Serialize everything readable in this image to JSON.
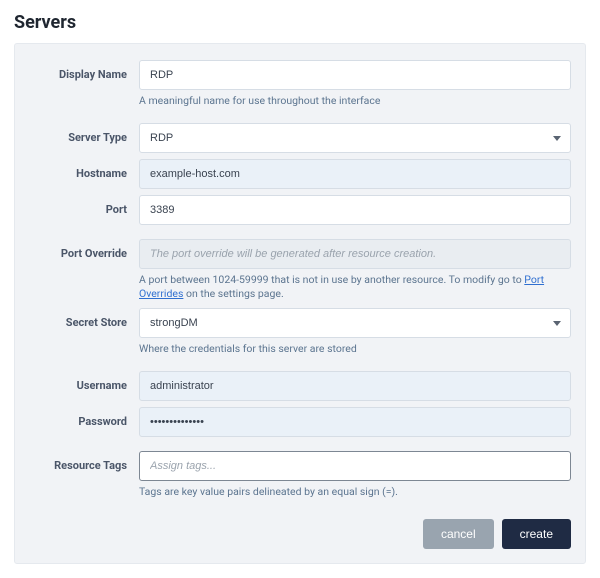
{
  "page": {
    "title": "Servers"
  },
  "fields": {
    "display_name": {
      "label": "Display Name",
      "value": "RDP",
      "hint": "A meaningful name for use throughout the interface"
    },
    "server_type": {
      "label": "Server Type",
      "value": "RDP"
    },
    "hostname": {
      "label": "Hostname",
      "value": "example-host.com"
    },
    "port": {
      "label": "Port",
      "value": "3389"
    },
    "port_override": {
      "label": "Port Override",
      "placeholder": "The port override will be generated after resource creation.",
      "hint_prefix": "A port between 1024-59999 that is not in use by another resource. To modify go to ",
      "hint_link": "Port Overrides",
      "hint_suffix": " on the settings page."
    },
    "secret_store": {
      "label": "Secret Store",
      "value": "strongDM",
      "hint": "Where the credentials for this server are stored"
    },
    "username": {
      "label": "Username",
      "value": "administrator"
    },
    "password": {
      "label": "Password",
      "value": "••••••••••••••"
    },
    "resource_tags": {
      "label": "Resource Tags",
      "placeholder": "Assign tags...",
      "hint": "Tags are key value pairs delineated by an equal sign (=)."
    }
  },
  "actions": {
    "cancel": "cancel",
    "create": "create"
  }
}
